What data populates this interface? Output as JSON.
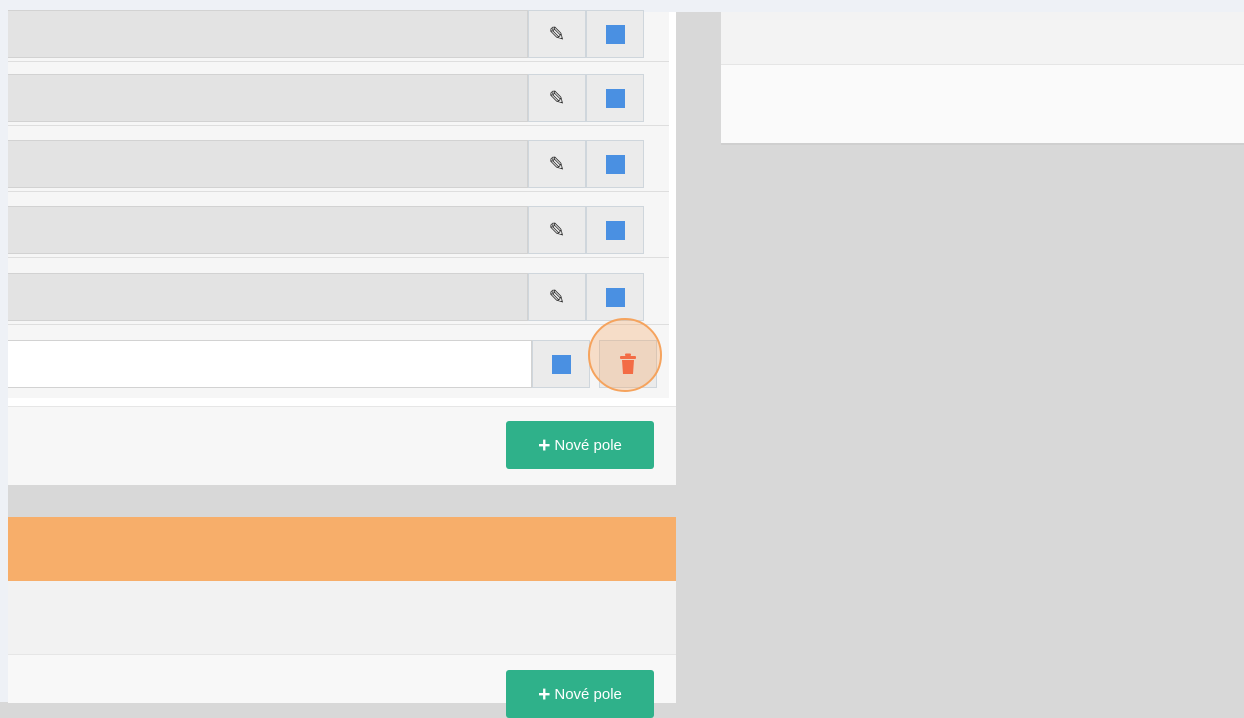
{
  "field_rows": [
    {
      "kind": "saved",
      "icons": [
        "edit-icon",
        "color-swatch"
      ]
    },
    {
      "kind": "saved",
      "icons": [
        "edit-icon",
        "color-swatch"
      ]
    },
    {
      "kind": "saved",
      "icons": [
        "edit-icon",
        "color-swatch"
      ]
    },
    {
      "kind": "saved",
      "icons": [
        "edit-icon",
        "color-swatch"
      ]
    },
    {
      "kind": "saved",
      "icons": [
        "edit-icon",
        "color-swatch"
      ]
    },
    {
      "kind": "editing",
      "icons": [
        "color-swatch",
        "trash-icon"
      ]
    }
  ],
  "upper_panel": {
    "new_field_label": "Nové pole"
  },
  "lower_panel": {
    "new_field_label": "Nové pole"
  },
  "colors": {
    "swatch_blue": "#4a90e2",
    "delete_red": "#f2553b",
    "accent_green": "#2fb18a",
    "header_orange": "#f7ae6a",
    "highlight_orange": "#f5a35d"
  }
}
